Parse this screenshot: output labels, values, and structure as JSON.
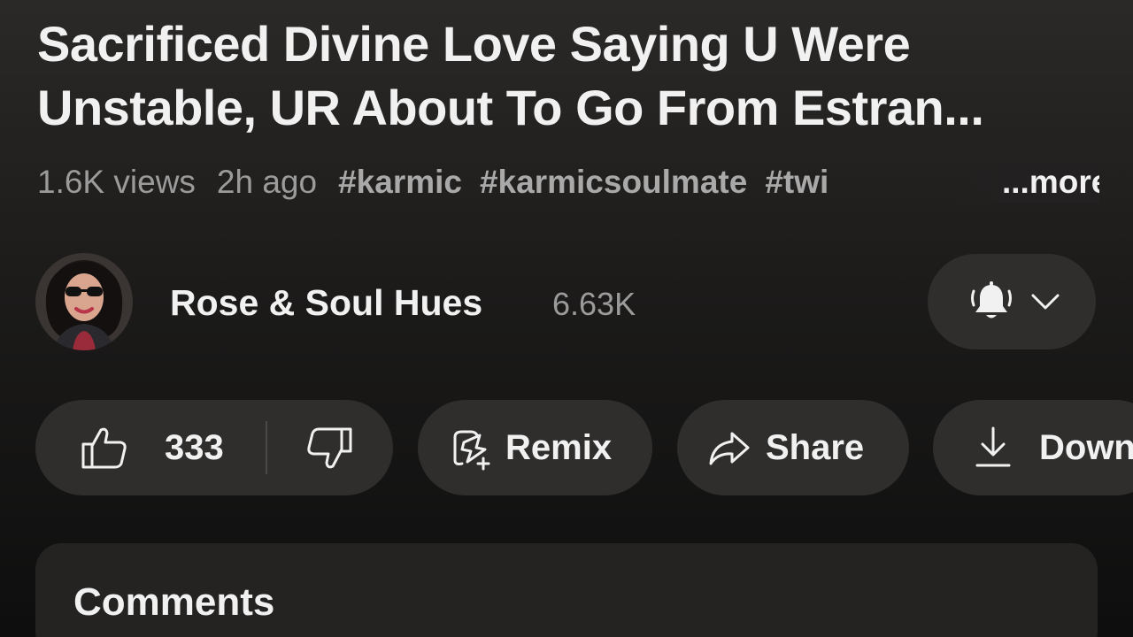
{
  "video": {
    "title_line1": "Sacrificed Divine Love Saying U Were",
    "title_line2": "Unstable, UR About To Go From Estran...",
    "views": "1.6K views",
    "posted": "2h ago",
    "hashtags": [
      "#karmic",
      "#karmicsoulmate",
      "#twi"
    ],
    "more_label": "...more"
  },
  "channel": {
    "name": "Rose & Soul Hues",
    "subscribers": "6.63K",
    "avatar_icon": "avatar"
  },
  "subscribe_button": {
    "icon": "bell-icon",
    "dropdown_icon": "chevron-down-icon"
  },
  "actions": {
    "like_count": "333",
    "like_icon": "thumbs-up-icon",
    "dislike_icon": "thumbs-down-icon",
    "remix_label": "Remix",
    "share_label": "Share",
    "download_label": "Down"
  },
  "comments": {
    "title": "Comments"
  },
  "colors": {
    "background_top": "#2b2927",
    "background_bottom": "#0e0e0e",
    "pill": "#2f2e2d",
    "text_primary": "#f1f1f1",
    "text_secondary": "#9b9b9b"
  }
}
